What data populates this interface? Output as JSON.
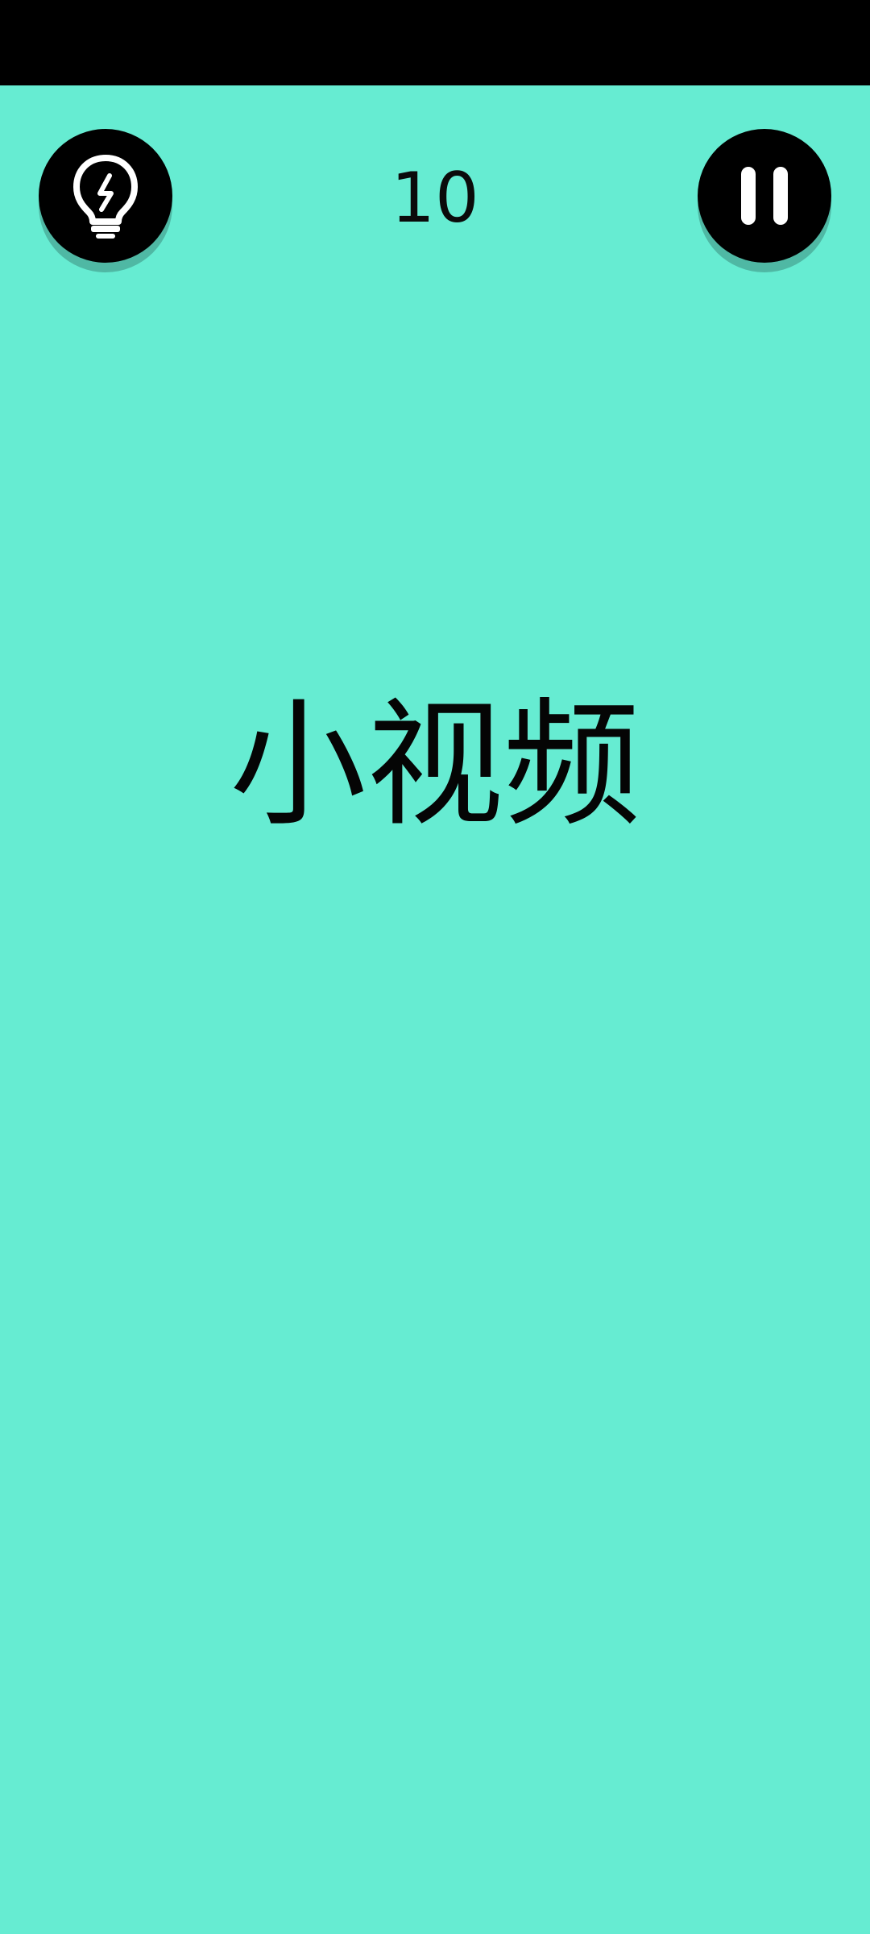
{
  "status_bar": {},
  "game": {
    "hint_icon": "lightbulb-icon",
    "pause_icon": "pause-icon",
    "counter": "10",
    "word": "小视频"
  },
  "colors": {
    "background": "#66ECD2",
    "button": "#000000",
    "icon": "#FFFFFF",
    "text": "#000000"
  }
}
